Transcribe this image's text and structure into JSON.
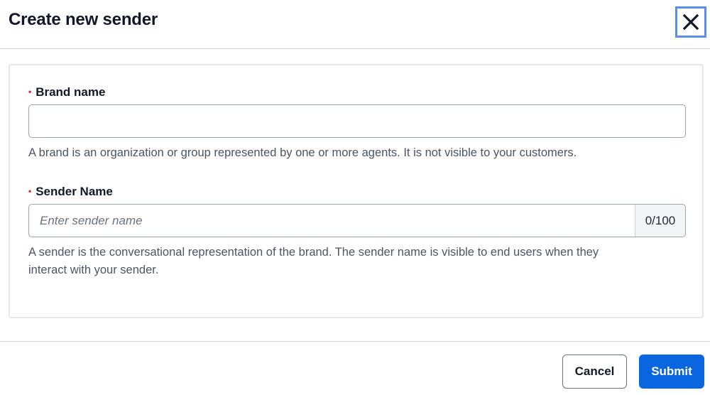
{
  "dialog": {
    "title": "Create new sender",
    "close_icon": "close-icon"
  },
  "form": {
    "brand": {
      "label": "Brand name",
      "required_marker": "•",
      "value": "",
      "help": "A brand is an organization or group represented by one or more agents. It is not visible to your customers."
    },
    "sender": {
      "label": "Sender Name",
      "required_marker": "•",
      "value": "",
      "placeholder": "Enter sender name",
      "counter": "0/100",
      "help_line1": "A sender is the conversational representation of the brand. The sender name is visible to end users when they",
      "help_line2": "interact with your sender."
    }
  },
  "footer": {
    "cancel_label": "Cancel",
    "submit_label": "Submit"
  },
  "colors": {
    "primary": "#0a66e0",
    "required": "#dc2626",
    "focus_ring": "#5b8def"
  }
}
